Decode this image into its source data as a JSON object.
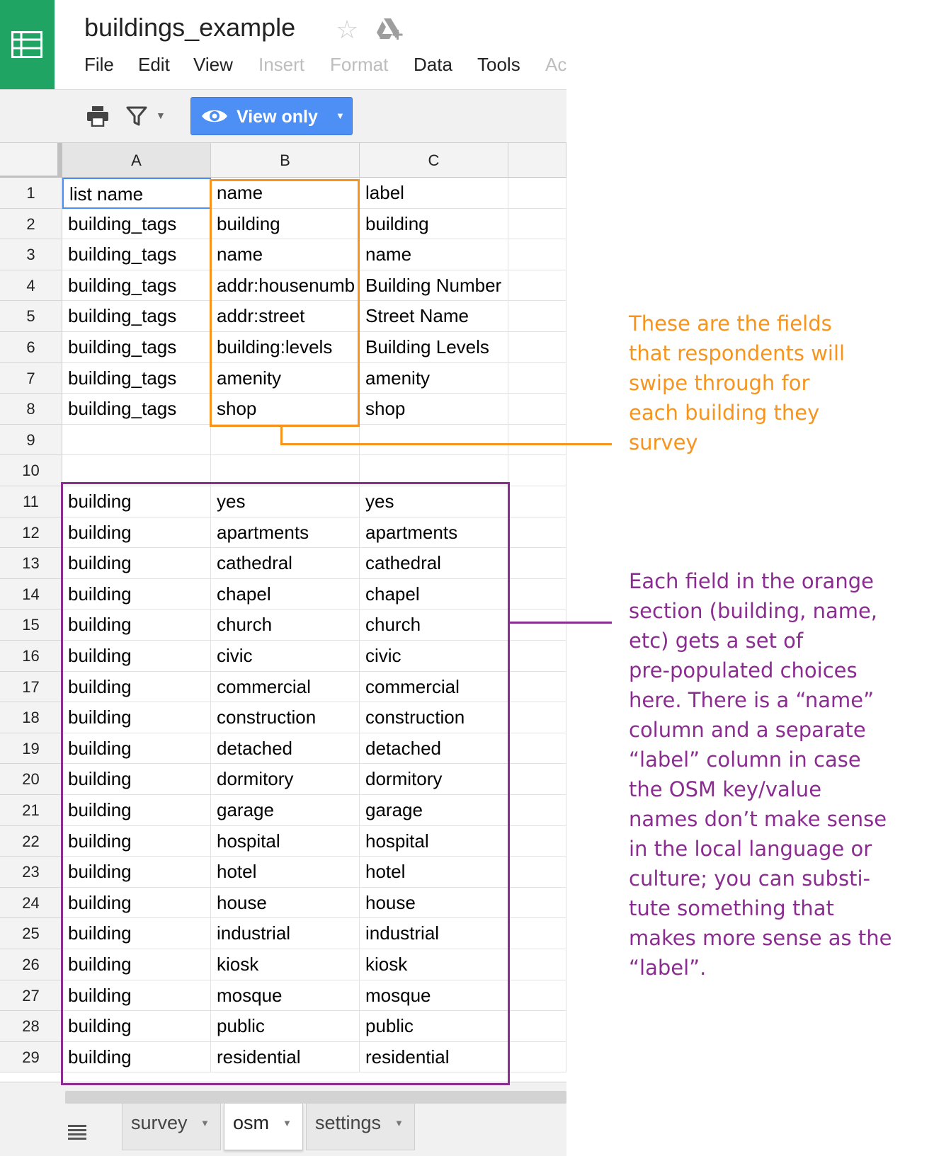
{
  "document": {
    "title": "buildings_example"
  },
  "menu": [
    "File",
    "Edit",
    "View",
    "Insert",
    "Format",
    "Data",
    "Tools",
    "Ac"
  ],
  "menu_disabled": [
    "Insert",
    "Format",
    "Ac"
  ],
  "toolbar": {
    "view_mode_label": "View only"
  },
  "columns": [
    "A",
    "B",
    "C"
  ],
  "rows": [
    {
      "n": "1",
      "a": "list name",
      "b": "name",
      "c": "label"
    },
    {
      "n": "2",
      "a": "building_tags",
      "b": "building",
      "c": "building"
    },
    {
      "n": "3",
      "a": "building_tags",
      "b": "name",
      "c": "name"
    },
    {
      "n": "4",
      "a": "building_tags",
      "b": "addr:housenumb",
      "c": "Building Number"
    },
    {
      "n": "5",
      "a": "building_tags",
      "b": "addr:street",
      "c": "Street Name"
    },
    {
      "n": "6",
      "a": "building_tags",
      "b": "building:levels",
      "c": "Building Levels"
    },
    {
      "n": "7",
      "a": "building_tags",
      "b": "amenity",
      "c": "amenity"
    },
    {
      "n": "8",
      "a": "building_tags",
      "b": "shop",
      "c": "shop"
    },
    {
      "n": "9",
      "a": "",
      "b": "",
      "c": ""
    },
    {
      "n": "10",
      "a": "",
      "b": "",
      "c": ""
    },
    {
      "n": "11",
      "a": "building",
      "b": "yes",
      "c": "yes"
    },
    {
      "n": "12",
      "a": "building",
      "b": "apartments",
      "c": "apartments"
    },
    {
      "n": "13",
      "a": "building",
      "b": "cathedral",
      "c": "cathedral"
    },
    {
      "n": "14",
      "a": "building",
      "b": "chapel",
      "c": "chapel"
    },
    {
      "n": "15",
      "a": "building",
      "b": "church",
      "c": "church"
    },
    {
      "n": "16",
      "a": "building",
      "b": "civic",
      "c": "civic"
    },
    {
      "n": "17",
      "a": "building",
      "b": "commercial",
      "c": "commercial"
    },
    {
      "n": "18",
      "a": "building",
      "b": "construction",
      "c": "construction"
    },
    {
      "n": "19",
      "a": "building",
      "b": "detached",
      "c": "detached"
    },
    {
      "n": "20",
      "a": "building",
      "b": "dormitory",
      "c": "dormitory"
    },
    {
      "n": "21",
      "a": "building",
      "b": "garage",
      "c": "garage"
    },
    {
      "n": "22",
      "a": "building",
      "b": "hospital",
      "c": "hospital"
    },
    {
      "n": "23",
      "a": "building",
      "b": "hotel",
      "c": "hotel"
    },
    {
      "n": "24",
      "a": "building",
      "b": "house",
      "c": "house"
    },
    {
      "n": "25",
      "a": "building",
      "b": "industrial",
      "c": "industrial"
    },
    {
      "n": "26",
      "a": "building",
      "b": "kiosk",
      "c": "kiosk"
    },
    {
      "n": "27",
      "a": "building",
      "b": "mosque",
      "c": "mosque"
    },
    {
      "n": "28",
      "a": "building",
      "b": "public",
      "c": "public"
    },
    {
      "n": "29",
      "a": "building",
      "b": "residential",
      "c": "residential"
    }
  ],
  "sheet_tabs": [
    {
      "label": "survey",
      "active": false
    },
    {
      "label": "osm",
      "active": true
    },
    {
      "label": "settings",
      "active": false
    }
  ],
  "annotations": {
    "orange": {
      "color": "#f7941d",
      "lines": [
        "These are the fields",
        "that respondents will",
        "swipe through for",
        "each building they",
        "survey"
      ]
    },
    "purple": {
      "color": "#8b2c91",
      "lines": [
        "Each field in the orange",
        "section (building, name,",
        "etc) gets a set of",
        "pre-populated choices",
        "here. There is a “name”",
        "column and a separate",
        "“label” column in case",
        "the OSM key/value",
        "names don’t make sense",
        "in the local language or",
        "culture; you can substi-",
        "tute something that",
        "makes more sense as the",
        "“label”."
      ]
    }
  },
  "colors": {
    "sheets_green": "#1fa463",
    "view_button_blue": "#4d8ff5",
    "selection_blue": "#4d8ff5"
  },
  "icons": [
    "sheets-logo-icon",
    "star-icon",
    "drive-add-icon",
    "print-icon",
    "filter-icon",
    "eye-icon",
    "sheets-menu-icon"
  ]
}
